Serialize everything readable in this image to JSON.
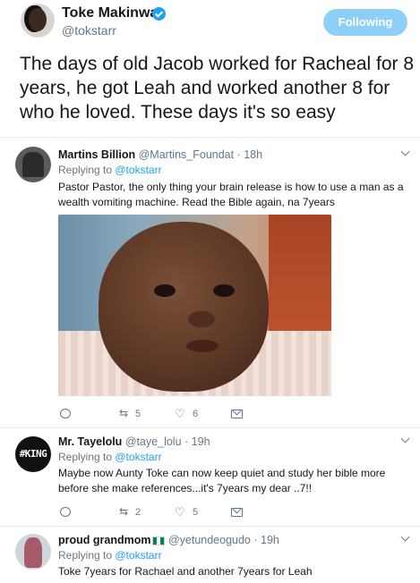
{
  "main_tweet": {
    "name": "Toke Makinwa",
    "handle": "@tokstarr",
    "follow_label": "Following",
    "text": "The days of old Jacob worked for Racheal for 8 years, he got Leah and worked another 8 for who he loved. These days it's so easy"
  },
  "replies": [
    {
      "name": "Martins Billion",
      "handle": "@Martins_Foundat",
      "time": "· 18h",
      "replying_prefix": "Replying to ",
      "replying_to": "@tokstarr",
      "text": "Pastor Pastor, the only thing your brain release is how to use a man as a wealth vomiting machine. Read the Bible again, na 7years",
      "retweets": "5",
      "likes": "6",
      "has_image": true
    },
    {
      "name": "Mr. Tayelolu",
      "handle": "@taye_lolu",
      "time": "· 19h",
      "avatar_text": "#KING",
      "replying_prefix": "Replying to ",
      "replying_to": "@tokstarr",
      "text": "Maybe now Aunty Toke can now keep quiet and study her bible more before she make references...it's 7years my dear ..7!!",
      "retweets": "2",
      "likes": "5"
    },
    {
      "name": "proud grandmom",
      "handle": "@yetundeogudo",
      "time": "· 19h",
      "replying_prefix": "Replying to ",
      "replying_to": "@tokstarr",
      "text": "Toke 7years for Rachael and another 7years for Leah"
    }
  ],
  "colors": {
    "accent": "#1da1f2",
    "follow_button": "#8dcff7",
    "secondary_text": "#657786",
    "divider": "#e6ecf0"
  },
  "icons": [
    "verified-badge-icon",
    "chevron-down-icon",
    "reply-icon",
    "retweet-icon",
    "heart-icon",
    "direct-message-icon",
    "nigeria-flag-icon"
  ]
}
